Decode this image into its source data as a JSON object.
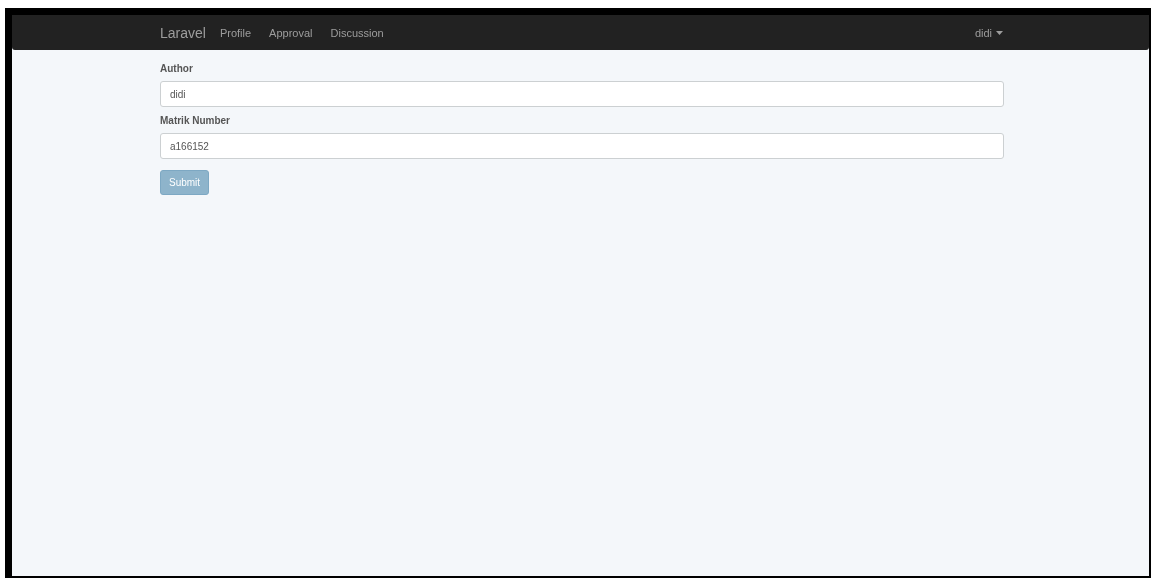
{
  "navbar": {
    "brand": "Laravel",
    "links": [
      {
        "label": "Profile"
      },
      {
        "label": "Approval"
      },
      {
        "label": "Discussion"
      }
    ],
    "user_menu": {
      "label": "didi"
    }
  },
  "form": {
    "fields": [
      {
        "label": "Author",
        "value": "didi"
      },
      {
        "label": "Matrik Number",
        "value": "a166152"
      }
    ],
    "submit": {
      "label": "Submit"
    }
  }
}
